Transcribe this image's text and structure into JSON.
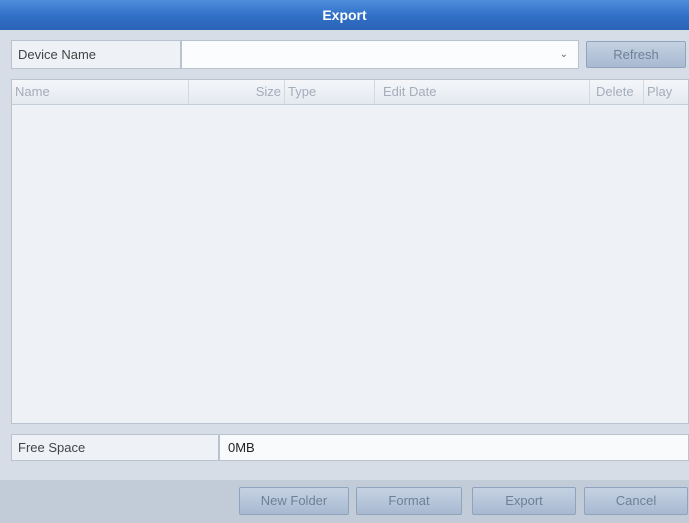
{
  "window": {
    "title": "Export"
  },
  "device": {
    "label": "Device Name",
    "selected_value": "",
    "dropdown_icon": "chevron-down-icon",
    "refresh_label": "Refresh"
  },
  "table": {
    "columns": [
      "Name",
      "Size",
      "Type",
      "Edit Date",
      "Delete",
      "Play"
    ],
    "rows": []
  },
  "free_space": {
    "label": "Free Space",
    "value": "0MB"
  },
  "buttons": {
    "new_folder": "New Folder",
    "format": "Format",
    "export": "Export",
    "cancel": "Cancel"
  }
}
